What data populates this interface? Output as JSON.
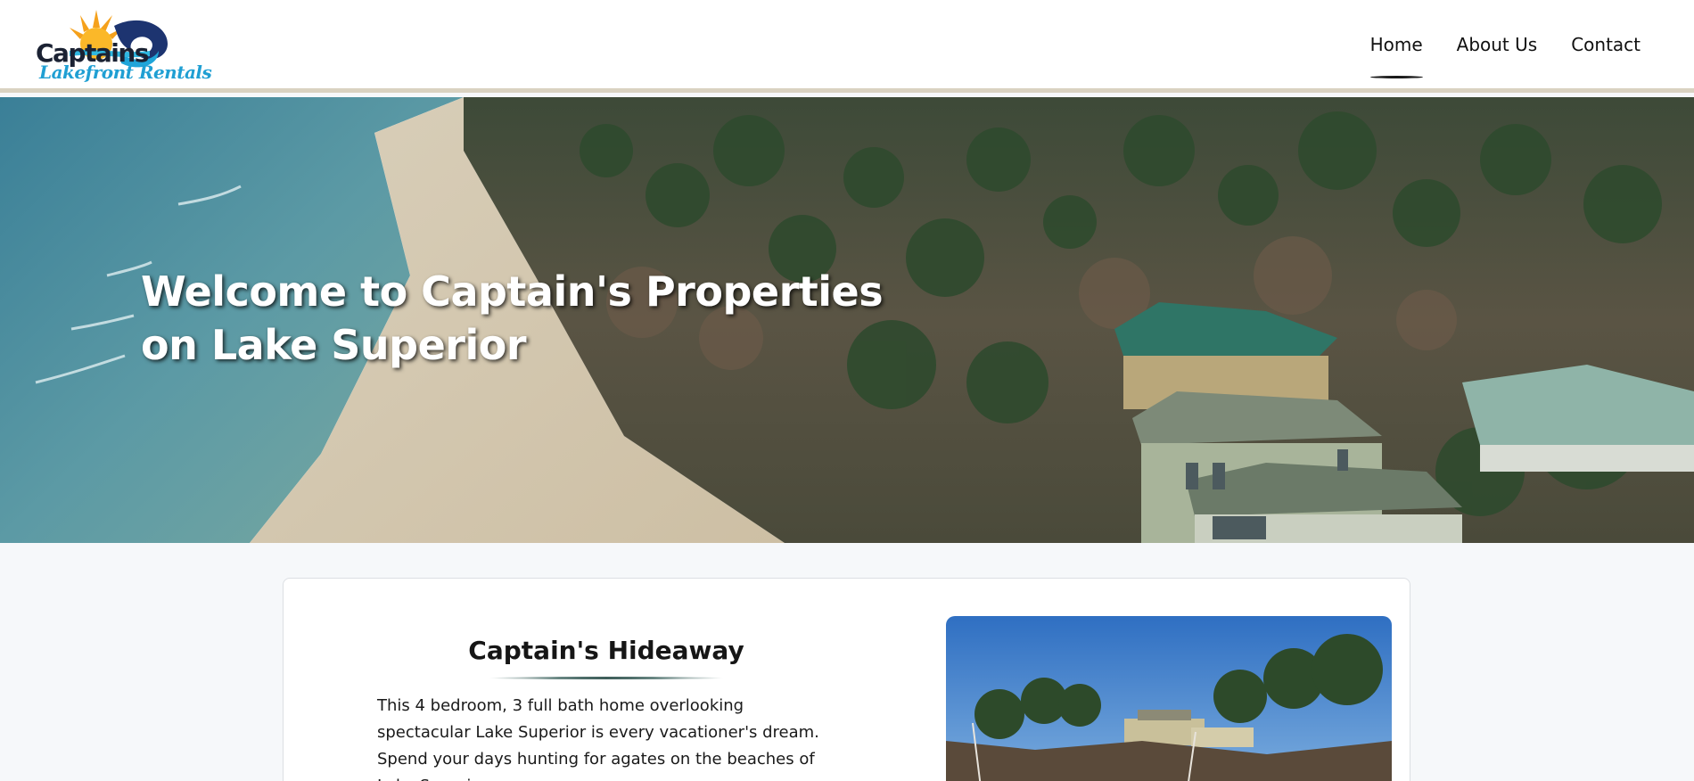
{
  "brand": {
    "logo_line1": "Captains",
    "logo_line2": "Lakefront Rentals"
  },
  "nav": {
    "items": [
      {
        "label": "Home",
        "active": true
      },
      {
        "label": "About Us",
        "active": false
      },
      {
        "label": "Contact",
        "active": false
      }
    ]
  },
  "hero": {
    "title": "Welcome to Captain's Properties on Lake Superior"
  },
  "property": {
    "title": "Captain's Hideaway",
    "description": "This 4 bedroom, 3 full bath home overlooking spectacular Lake Superior is every vacationer's dream. Spend your days hunting for agates on the beaches of Lake Superior,"
  },
  "colors": {
    "accent_blue": "#1f9fd3",
    "logo_navy": "#1b2233",
    "header_border": "#d9d2c1"
  }
}
